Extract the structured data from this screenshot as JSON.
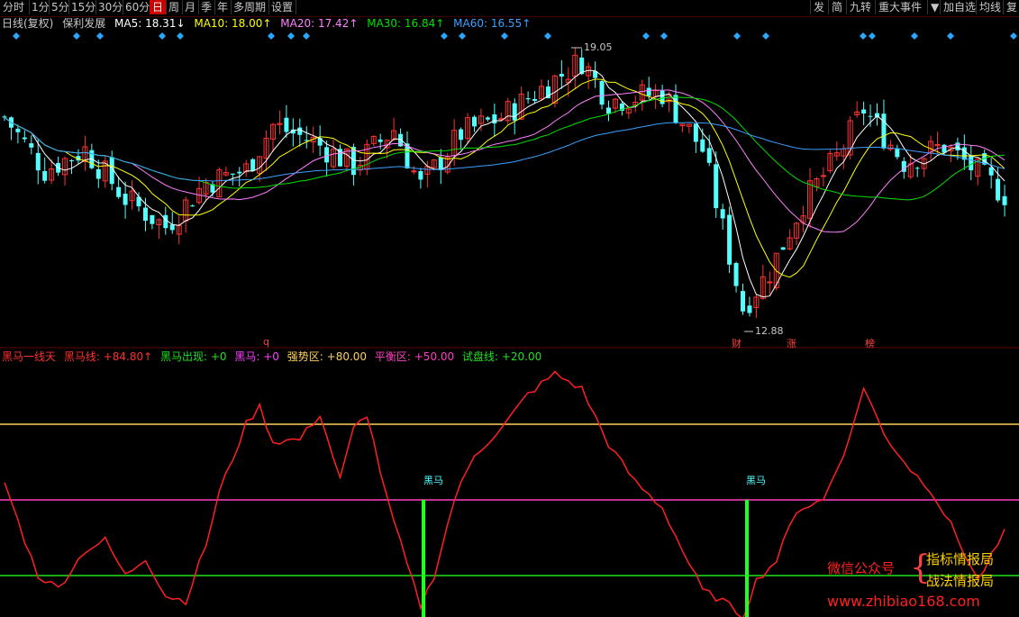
{
  "toolbar": {
    "left": [
      "分时",
      "1分",
      "5分",
      "15分",
      "30分",
      "60分",
      "日",
      "周",
      "月",
      "季",
      "年",
      "多周期",
      "设置"
    ],
    "active": "日",
    "right": [
      "发",
      "简",
      "九转",
      "重大事件",
      "▼",
      "加自选",
      "均线",
      "复"
    ]
  },
  "info": {
    "period": "日线(复权)",
    "stock": "保利发展",
    "ma5": "MA5: 18.31↓",
    "ma10": "MA10: 18.00↑",
    "ma20": "MA20: 17.42↑",
    "ma30": "MA30: 16.84↑",
    "ma60": "MA60: 16.55↑"
  },
  "colors": {
    "up": "#ff3232",
    "down": "#54ffff",
    "ma5": "#ffffff",
    "ma10": "#ffff00",
    "ma20": "#ff80ff",
    "ma30": "#00e000",
    "ma60": "#3ca0ff",
    "osc": "#ff2020",
    "strong": "#ffd060",
    "balance": "#ff40c0",
    "test": "#20e020",
    "signal": "#20ff20"
  },
  "price": {
    "high_label": "19.05",
    "low_label": "12.88",
    "ylim": [
      12.5,
      19.6
    ]
  },
  "events": [
    "q",
    "财",
    "涨",
    "榜"
  ],
  "indicator": {
    "name": "黑马一线天",
    "line": "黑马线: +84.80↑",
    "appear": "黑马出现: +0",
    "horse": "黑马: +0",
    "strong": "强势区: +80.00",
    "balance": "平衡区: +50.00",
    "test": "试盘线: +20.00",
    "signal_label_1": "黑马",
    "signal_label_2": "黑马"
  },
  "watermark": {
    "wechat": "微信公众号",
    "brand1": "指标情报局",
    "brand2": "战法情报局",
    "url": "www.zhibiao168.com"
  }
}
